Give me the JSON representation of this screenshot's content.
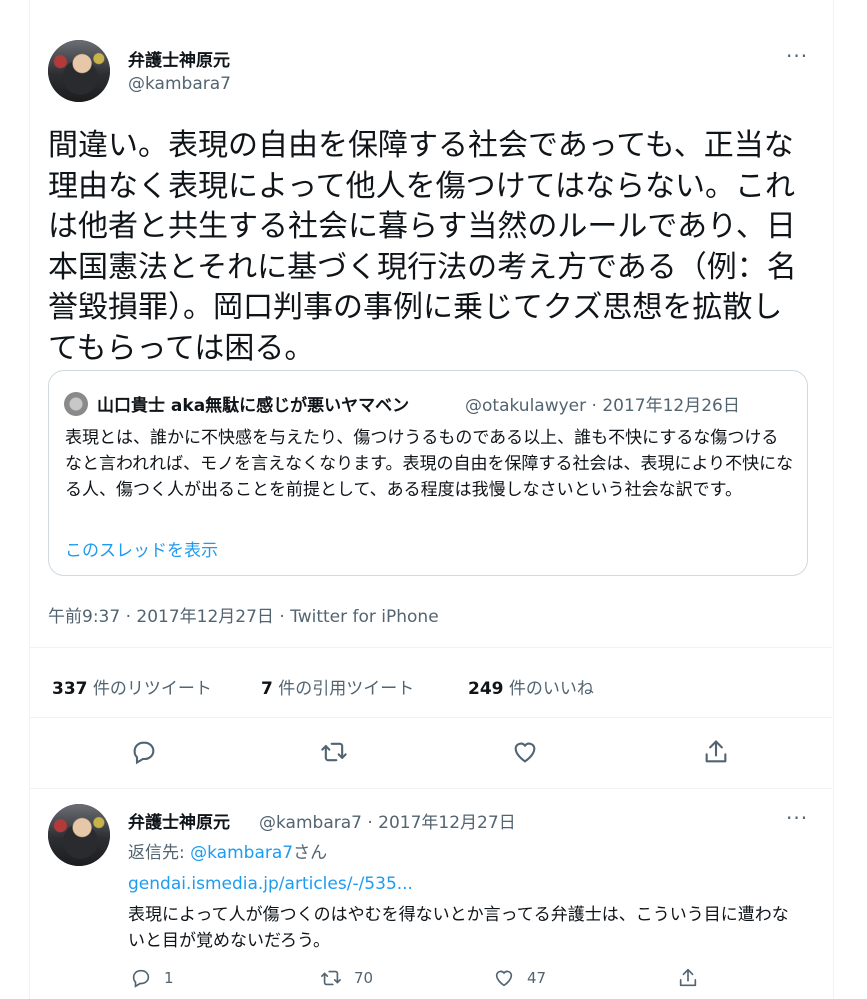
{
  "main_tweet": {
    "author_name": "弁護士神原元",
    "author_handle": "@kambara7",
    "more_label": "···",
    "text": "間違い。表現の自由を保障する社会であっても、正当な理由なく表現によって他人を傷つけてはならない。これは他者と共生する社会に暮らす当然のルールであり、日本国憲法とそれに基づく現行法の考え方である（例：名誉毀損罪）。岡口判事の事例に乗じてクズ思想を拡散してもらっては困る。",
    "quote": {
      "author_name": "山口貴士 aka無駄に感じが悪いヤマベン",
      "meta": "@otakulawyer · 2017年12月26日",
      "text": "表現とは、誰かに不快感を与えたり、傷つけうるものである以上、誰も不快にするな傷つけるなと言われれば、モノを言えなくなります。表現の自由を保障する社会は、表現により不快になる人、傷つく人が出ることを前提として、ある程度は我慢しなさいという社会な訳です。",
      "show_thread": "このスレッドを表示"
    },
    "timestamp": "午前9:37 · 2017年12月27日 · Twitter for iPhone",
    "stats": {
      "retweets_count": "337",
      "retweets_label": "件のリツイート",
      "quotes_count": "7",
      "quotes_label": "件の引用ツイート",
      "likes_count": "249",
      "likes_label": "件のいいね"
    },
    "actions": [
      "reply-icon",
      "retweet-icon",
      "like-icon",
      "share-icon"
    ]
  },
  "reply_tweet": {
    "author_name": "弁護士神原元",
    "meta": "@kambara7 · 2017年12月27日",
    "more_label": "···",
    "reply_to_prefix": "返信先: ",
    "reply_to_handle": "@kambara7",
    "reply_to_suffix": "さん",
    "link": "gendai.ismedia.jp/articles/-/535...",
    "text": "表現によって人が傷つくのはやむを得ないとか言ってる弁護士は、こういう目に遭わないと目が覚めないだろう。",
    "reply_count": "1",
    "retweet_count": "70",
    "like_count": "47"
  },
  "colors": {
    "text": "#0f1419",
    "secondary": "#536471",
    "link": "#1d9bf0",
    "border": "#cfd9de"
  }
}
